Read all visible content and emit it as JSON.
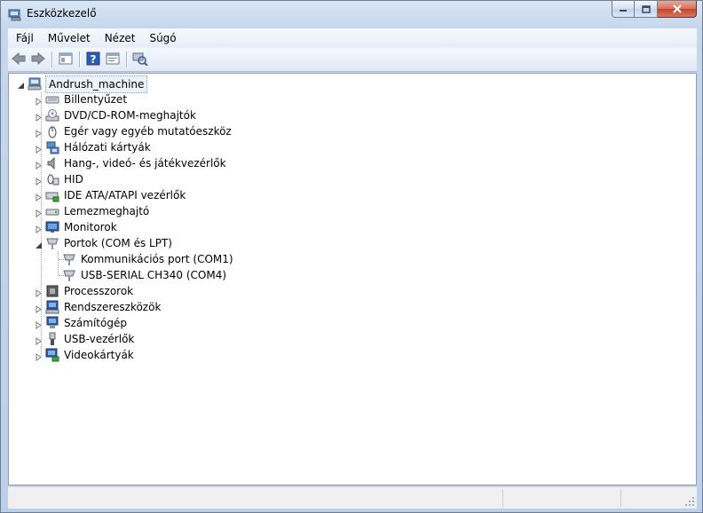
{
  "window": {
    "title": "Eszközkezelő"
  },
  "menu": [
    "Fájl",
    "Művelet",
    "Nézet",
    "Súgó"
  ],
  "toolbar": {
    "buttons": [
      "back-icon",
      "forward-icon",
      "show-hide-tree-icon",
      "help-icon",
      "properties-icon",
      "scan-hardware-icon"
    ]
  },
  "tree": {
    "root": "Andrush_machine",
    "categories": [
      {
        "label": "Billentyűzet",
        "icon": "keyboard-icon"
      },
      {
        "label": "DVD/CD-ROM-meghajtók",
        "icon": "dvd-drive-icon"
      },
      {
        "label": "Egér vagy egyéb mutatóeszköz",
        "icon": "mouse-icon"
      },
      {
        "label": "Hálózati kártyák",
        "icon": "network-adapter-icon"
      },
      {
        "label": "Hang-, videó- és játékvezérlők",
        "icon": "speaker-icon"
      },
      {
        "label": "HID",
        "icon": "hid-icon"
      },
      {
        "label": "IDE ATA/ATAPI vezérlők",
        "icon": "ide-controller-icon"
      },
      {
        "label": "Lemezmeghajtó",
        "icon": "disk-drive-icon"
      },
      {
        "label": "Monitorok",
        "icon": "monitor-icon"
      },
      {
        "label": "Portok (COM és LPT)",
        "icon": "port-icon",
        "expanded": true,
        "children": [
          {
            "label": "Kommunikációs port (COM1)",
            "icon": "port-icon"
          },
          {
            "label": "USB-SERIAL CH340 (COM4)",
            "icon": "port-icon"
          }
        ]
      },
      {
        "label": "Processzorok",
        "icon": "processor-icon"
      },
      {
        "label": "Rendszereszközök",
        "icon": "system-devices-icon"
      },
      {
        "label": "Számítógép",
        "icon": "computer-icon"
      },
      {
        "label": "USB-vezérlők",
        "icon": "usb-icon"
      },
      {
        "label": "Videokártyák",
        "icon": "display-adapter-icon"
      }
    ]
  }
}
